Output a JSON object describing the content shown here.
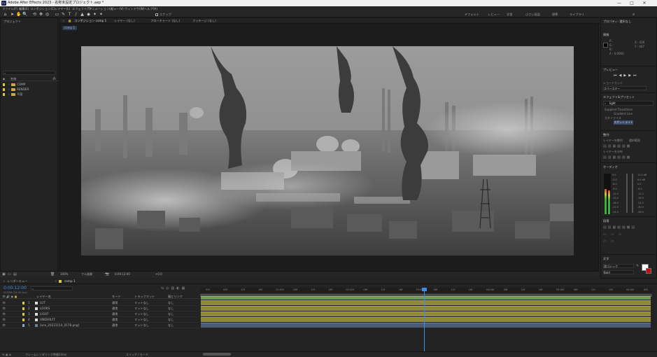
{
  "window": {
    "title": "Adobe After Effects 2023 - 名称未設定プロジェクト.aep *",
    "app_icon_label": "Ae",
    "controls": [
      "—",
      "□",
      "✕"
    ]
  },
  "menu": [
    "ファイル(F)",
    "編集(E)",
    "コンポジション(C)",
    "レイヤー(L)",
    "エフェクト(T)",
    "アニメーション(A)",
    "ビュー(V)",
    "ウィンドウ(W)",
    "ヘルプ(H)"
  ],
  "toolbar": {
    "tools": [
      "⌂",
      "➤",
      "✋",
      "🔍",
      "⟲",
      "✥",
      "◎",
      "▭",
      "✎",
      "T",
      "/",
      "▲",
      "◆",
      "✦",
      "✶"
    ],
    "snap_label": "スナップ",
    "workspaces": [
      "デフォルト",
      "レビュー",
      "学習",
      "小さい画面",
      "標準",
      "ライブラリ"
    ],
    "search_icon": "search-icon"
  },
  "project_panel": {
    "tab": "プロジェクト",
    "column_name": "名前",
    "items": [
      {
        "name": "COMP",
        "type": "folder"
      },
      {
        "name": "RENDER",
        "type": "folder"
      },
      {
        "name": "平面",
        "type": "folder"
      }
    ]
  },
  "comp_panel": {
    "tabs": [
      "コンポジション comp 1",
      "レイヤー (なし)",
      "フローチャート (なし)",
      "フッテージ (なし)"
    ],
    "breadcrumb": "comp 1",
    "zoom": "100%",
    "quality": "フル画質",
    "timecode": "0:00:12:00",
    "camera": "アクティブカメラ",
    "views": "1画面",
    "offset": "+0.0"
  },
  "info_panel": {
    "tab": "プロパティ: 選択なし",
    "sub_tab": "情報",
    "values": [
      "R :",
      "G :",
      "B :",
      "A : 0.0000"
    ],
    "coords": [
      "X : 436",
      "Y : 407"
    ]
  },
  "preview_panel": {
    "tab": "プレビュー",
    "shortcut_label": "ショートカット",
    "shortcut_value": "スペースキー"
  },
  "effects_panel": {
    "tab": "エフェクト&プリセット",
    "search": "light",
    "items": [
      "Supplied Transitions",
      "Gradient Line",
      "スタイライズ",
      "スポットライト"
    ]
  },
  "align_panel": {
    "tab": "整列",
    "label": "レイヤーを整列",
    "value": "選択範囲",
    "distribute": "レイヤーを分布"
  },
  "audio_panel": {
    "tab": "オーディオ",
    "left_scale": [
      "0.0",
      "-3.0",
      "-6.0",
      "-9.0",
      "-12.0",
      "-15.0",
      "-18.0",
      "-21.0",
      "-24.0"
    ],
    "right_scale": [
      "12.0 dB",
      "6.0 dB",
      "0.0",
      "-6.0",
      "-12.0",
      "-18.0",
      "-24.0",
      "-30.0",
      "-36.0"
    ],
    "level_left": 0.62,
    "level_right": 0.58
  },
  "paragraph_panel": {
    "tab": "段落"
  },
  "character_panel": {
    "tab": "文字",
    "font": "游ゴシック",
    "style": "Bold"
  },
  "timeline": {
    "tabs": [
      "レンダーキュー",
      "comp 1"
    ],
    "timecode": "0:00:12:00",
    "frame_info": "00288 (24.00 fps)",
    "search": "",
    "columns": {
      "layer_name": "レイヤー名",
      "mode": "モード",
      "trkmat": "トラックマット",
      "parent": "親とリンク"
    },
    "layers": [
      {
        "index": "1",
        "name": "LUT",
        "mode": "通常",
        "trkmat": "マットなし",
        "parent": "なし"
      },
      {
        "index": "2",
        "name": "LOOKS",
        "mode": "通常",
        "trkmat": "マットなし",
        "parent": "なし"
      },
      {
        "index": "3",
        "name": "LIGHT",
        "mode": "通常",
        "trkmat": "マットなし",
        "parent": "なし"
      },
      {
        "index": "4",
        "name": "UNDERLYT",
        "mode": "通常",
        "trkmat": "マットなし",
        "parent": "なし"
      },
      {
        "index": "5",
        "name": "[ece_20231114_0178.png]",
        "mode": "通常",
        "trkmat": "マットなし",
        "parent": "なし"
      }
    ],
    "ruler_labels": [
      "00f",
      "06f",
      "12f",
      "18f",
      "01:00f",
      "06f",
      "12f",
      "18f",
      "02:00f",
      "06f",
      "12f",
      "18f",
      "03:00f",
      "06f",
      "12f",
      "18f",
      "04:00f",
      "06f",
      "12f",
      "18f",
      "05:00f",
      "06f",
      "12f",
      "18f",
      "06:00f",
      "06f"
    ],
    "playhead": 0.495,
    "footer_left": "フレームレンダリング時間",
    "footer_left_value": "24ms",
    "footer_mid": "スイッチ / モード"
  }
}
